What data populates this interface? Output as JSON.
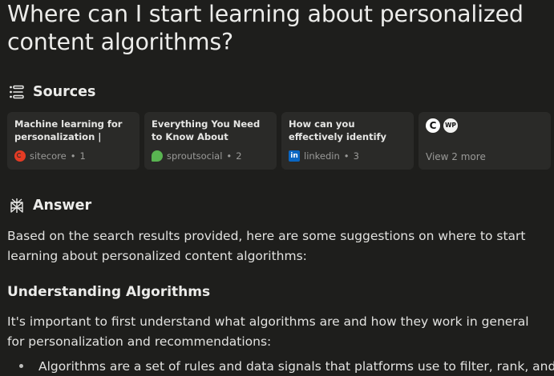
{
  "question": "Where can I start learning about personalized content algorithms?",
  "sources": {
    "heading": "Sources",
    "cards": [
      {
        "title": "Machine learning for personalization | Sitecor...",
        "site": "sitecore",
        "index": "1",
        "icon": "sitecore-favicon"
      },
      {
        "title": "Everything You Need to Know About Social...",
        "site": "sproutsocial",
        "index": "2",
        "icon": "sproutsocial-favicon"
      },
      {
        "title": "How can you effectively identify the best...",
        "site": "linkedin",
        "index": "3",
        "icon": "linkedin-favicon"
      }
    ],
    "more": {
      "icons": [
        "C",
        "WP"
      ],
      "label": "View 2 more"
    }
  },
  "answer": {
    "heading": "Answer",
    "intro": "Based on the search results provided, here are some suggestions on where to start learning about personalized content algorithms:",
    "subheading": "Understanding Algorithms",
    "para": "It's important to first understand what algorithms are and how they work in general for personalization and recommendations:",
    "bullet": "Algorithms are a set of rules and data signals that platforms use to filter, rank, and"
  },
  "separator": "•",
  "colors": {
    "background": "#1e1e1c",
    "card": "#2a2a28",
    "text": "#e8e8e6",
    "muted": "#9a9a98",
    "sitecore": "#e53b24",
    "sprout": "#59b451",
    "linkedin": "#0a66c2"
  }
}
